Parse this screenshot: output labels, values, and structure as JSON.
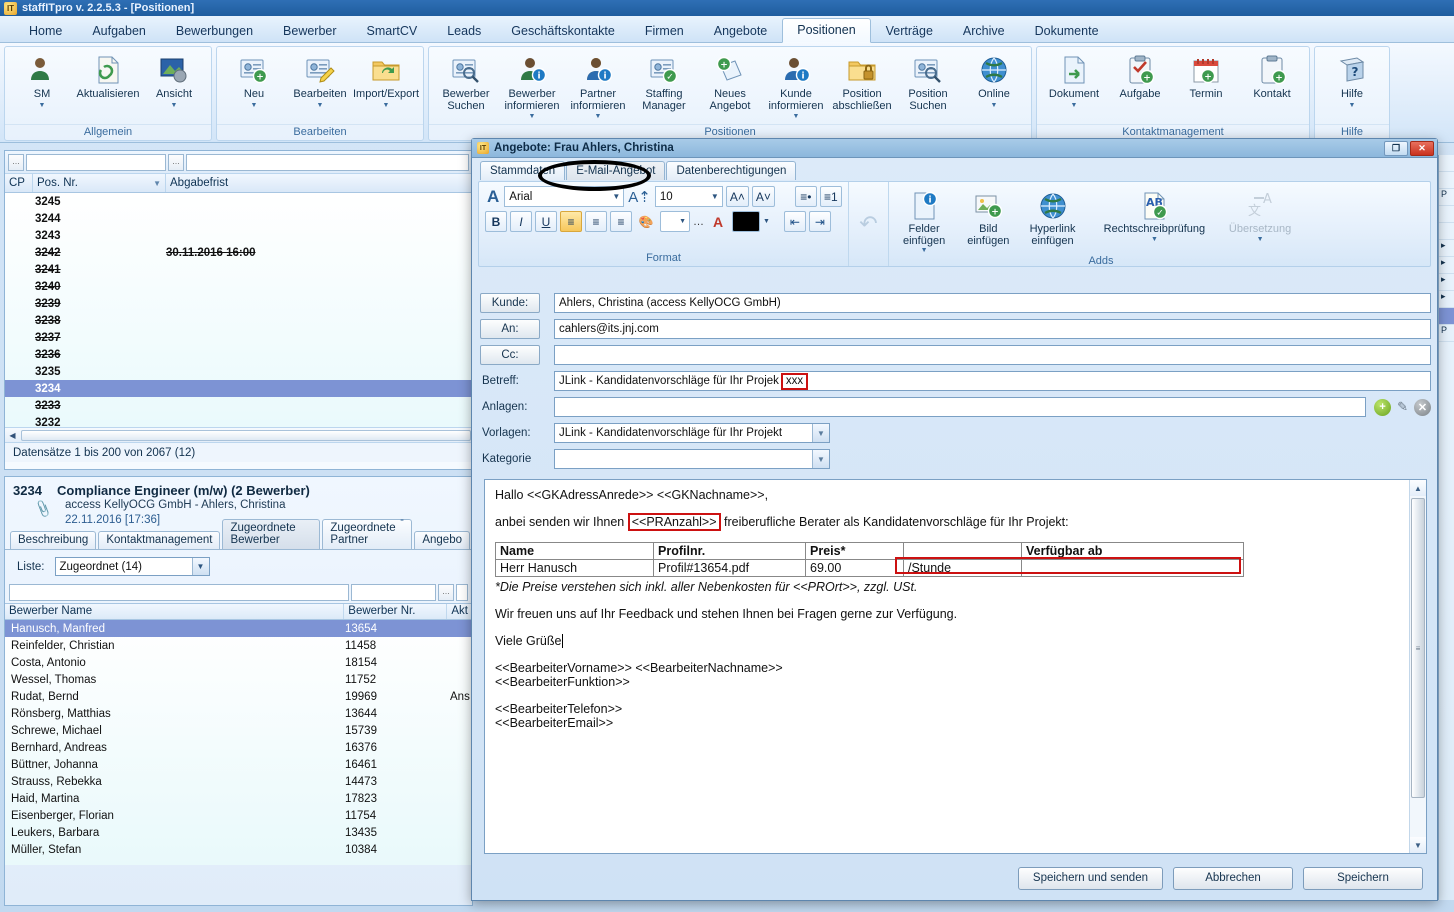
{
  "app": {
    "title": "staffITpro v. 2.2.5.3 - [Positionen]",
    "logo": "IT"
  },
  "ribbon": {
    "tabs": [
      {
        "label": "Home",
        "active": false
      },
      {
        "label": "Aufgaben",
        "active": false
      },
      {
        "label": "Bewerbungen",
        "active": false
      },
      {
        "label": "Bewerber",
        "active": false
      },
      {
        "label": "SmartCV",
        "active": false
      },
      {
        "label": "Leads",
        "active": false
      },
      {
        "label": "Geschäftskontakte",
        "active": false
      },
      {
        "label": "Firmen",
        "active": false
      },
      {
        "label": "Angebote",
        "active": false
      },
      {
        "label": "Positionen",
        "active": true
      },
      {
        "label": "Verträge",
        "active": false
      },
      {
        "label": "Archive",
        "active": false
      },
      {
        "label": "Dokumente",
        "active": false
      }
    ],
    "groups": [
      {
        "label": "Allgemein",
        "buttons": [
          {
            "label": "SM",
            "icon": "person-icon",
            "caret": true
          },
          {
            "label": "Aktualisieren",
            "icon": "refresh-link-icon",
            "caret": false
          },
          {
            "label": "Ansicht",
            "icon": "view-settings-icon",
            "caret": true
          }
        ]
      },
      {
        "label": "Bearbeiten",
        "buttons": [
          {
            "label": "Neu",
            "icon": "new-record-icon",
            "caret": true
          },
          {
            "label": "Bearbeiten",
            "icon": "edit-record-icon",
            "caret": true
          },
          {
            "label": "Import/Export",
            "icon": "folder-sync-icon",
            "caret": true
          }
        ]
      },
      {
        "label": "Positionen",
        "buttons": [
          {
            "label": "Bewerber\nSuchen",
            "icon": "person-search-icon",
            "caret": false
          },
          {
            "label": "Bewerber\ninformieren",
            "icon": "person-info-icon",
            "caret": true
          },
          {
            "label": "Partner\ninformieren",
            "icon": "partner-info-icon",
            "caret": true
          },
          {
            "label": "Staffing\nManager",
            "icon": "person-check-icon",
            "caret": false
          },
          {
            "label": "Neues\nAngebot",
            "icon": "new-offer-icon",
            "caret": false
          },
          {
            "label": "Kunde\ninformieren",
            "icon": "customer-info-icon",
            "caret": true
          },
          {
            "label": "Position\nabschließen",
            "icon": "folder-lock-icon",
            "caret": false
          },
          {
            "label": "Position\nSuchen",
            "icon": "position-search-icon",
            "caret": false
          },
          {
            "label": "Online",
            "icon": "globe-icon",
            "caret": true
          }
        ]
      },
      {
        "label": "Kontaktmanagement",
        "buttons": [
          {
            "label": "Dokument",
            "icon": "document-icon",
            "caret": true
          },
          {
            "label": "Aufgabe",
            "icon": "task-add-icon",
            "caret": false
          },
          {
            "label": "Termin",
            "icon": "calendar-add-icon",
            "caret": false
          },
          {
            "label": "Kontakt",
            "icon": "contact-add-icon",
            "caret": false
          }
        ]
      },
      {
        "label": "Hilfe",
        "buttons": [
          {
            "label": "Hilfe",
            "icon": "help-book-icon",
            "caret": true
          }
        ]
      }
    ]
  },
  "positions_grid": {
    "columns": [
      "CP",
      "Pos. Nr.",
      "Abgabefrist"
    ],
    "sorted_column": "Pos. Nr.",
    "rows": [
      {
        "nr": "3245",
        "frist": "",
        "strike": false,
        "selected": false
      },
      {
        "nr": "3244",
        "frist": "",
        "strike": false,
        "selected": false
      },
      {
        "nr": "3243",
        "frist": "",
        "strike": false,
        "selected": false
      },
      {
        "nr": "3242",
        "frist": "30.11.2016 16:00",
        "strike": true,
        "selected": false
      },
      {
        "nr": "3241",
        "frist": "",
        "strike": true,
        "selected": false
      },
      {
        "nr": "3240",
        "frist": "",
        "strike": true,
        "selected": false
      },
      {
        "nr": "3239",
        "frist": "",
        "strike": true,
        "selected": false
      },
      {
        "nr": "3238",
        "frist": "",
        "strike": true,
        "selected": false
      },
      {
        "nr": "3237",
        "frist": "",
        "strike": true,
        "selected": false
      },
      {
        "nr": "3236",
        "frist": "",
        "strike": true,
        "selected": false
      },
      {
        "nr": "3235",
        "frist": "",
        "strike": false,
        "selected": false
      },
      {
        "nr": "3234",
        "frist": "",
        "strike": false,
        "selected": true
      },
      {
        "nr": "3233",
        "frist": "",
        "strike": true,
        "selected": false
      },
      {
        "nr": "3232",
        "frist": "",
        "strike": false,
        "selected": false
      }
    ],
    "status": "Datensätze 1 bis 200 von 2067 (12)"
  },
  "detail": {
    "number": "3234",
    "title": "Compliance Engineer (m/w) (2 Bewerber)",
    "subtitle": "access KellyOCG GmbH - Ahlers, Christina",
    "date": "22.11.2016 [17:36]",
    "date_right": "-",
    "tabs": [
      {
        "label": "Beschreibung",
        "active": false
      },
      {
        "label": "Kontaktmanagement",
        "active": false
      },
      {
        "label": "Zugeordnete Bewerber",
        "active": true
      },
      {
        "label": "Zugeordnete Partner",
        "active": false
      },
      {
        "label": "Angebo",
        "active": false
      }
    ],
    "liste_label": "Liste:",
    "liste_value": "Zugeordnet (14)",
    "columns": [
      "Bewerber Name",
      "Bewerber Nr.",
      "Akt"
    ],
    "rows": [
      {
        "name": "Hanusch, Manfred",
        "nr": "13654",
        "akt": "",
        "selected": true
      },
      {
        "name": "Reinfelder, Christian",
        "nr": "11458",
        "akt": "",
        "selected": false
      },
      {
        "name": "Costa, Antonio",
        "nr": "18154",
        "akt": "",
        "selected": false
      },
      {
        "name": "Wessel, Thomas",
        "nr": "11752",
        "akt": "",
        "selected": false
      },
      {
        "name": "Rudat, Bernd",
        "nr": "19969",
        "akt": "Ans",
        "selected": false
      },
      {
        "name": "Rönsberg, Matthias",
        "nr": "13644",
        "akt": "",
        "selected": false
      },
      {
        "name": "Schrewe, Michael",
        "nr": "15739",
        "akt": "",
        "selected": false
      },
      {
        "name": "Bernhard, Andreas",
        "nr": "16376",
        "akt": "",
        "selected": false
      },
      {
        "name": "Büttner, Johanna",
        "nr": "16461",
        "akt": "",
        "selected": false
      },
      {
        "name": "Strauss, Rebekka",
        "nr": "14473",
        "akt": "",
        "selected": false
      },
      {
        "name": "Haid, Martina",
        "nr": "17823",
        "akt": "",
        "selected": false
      },
      {
        "name": "Eisenberger, Florian",
        "nr": "11754",
        "akt": "",
        "selected": false
      },
      {
        "name": "Leukers, Barbara",
        "nr": "13435",
        "akt": "",
        "selected": false
      },
      {
        "name": "Müller, Stefan",
        "nr": "10384",
        "akt": "",
        "selected": false
      }
    ]
  },
  "dialog": {
    "title": "Angebote: Frau Ahlers, Christina",
    "logo": "IT",
    "restore_label": "❐",
    "close_label": "✕",
    "tabs": [
      {
        "label": "Stammdaten",
        "active": false
      },
      {
        "label": "E-Mail-Angebot",
        "active": true
      },
      {
        "label": "Datenberechtigungen",
        "active": false
      }
    ],
    "format": {
      "group_label": "Format",
      "font_icon": "font-color-A-icon",
      "font_name": "Arial",
      "size_icon": "font-size-icon",
      "font_size": "10",
      "grow_font": "A˄",
      "shrink_font": "A˅",
      "bold": "B",
      "italic": "I",
      "underline": "U",
      "align_left": "≡",
      "align_center": "≡",
      "align_right": "≡",
      "highlight_icon": "highlight-fill-icon",
      "fill_more": "…",
      "font_color_icon": "font-color-icon",
      "bullets": "bullet-list-icon",
      "numbering": "numbered-list-icon",
      "outdent": "decrease-indent-icon",
      "indent": "increase-indent-icon",
      "undo": "undo-icon"
    },
    "adds": {
      "group_label": "Adds",
      "buttons": [
        {
          "label": "Felder\neinfügen",
          "icon": "insert-field-icon",
          "caret": true,
          "disabled": false
        },
        {
          "label": "Bild\neinfügen",
          "icon": "insert-image-icon",
          "caret": false,
          "disabled": false
        },
        {
          "label": "Hyperlink\neinfügen",
          "icon": "insert-hyperlink-icon",
          "caret": false,
          "disabled": false
        },
        {
          "label": "Rechtschreibprüfung",
          "icon": "spellcheck-icon",
          "caret": true,
          "disabled": false
        },
        {
          "label": "Übersetzung",
          "icon": "translate-icon",
          "caret": true,
          "disabled": true
        }
      ]
    },
    "fields": {
      "kunde_label": "Kunde:",
      "kunde_value": "Ahlers, Christina (access KellyOCG GmbH)",
      "an_label": "An:",
      "an_value": "cahlers@its.jnj.com",
      "cc_label": "Cc:",
      "cc_value": "",
      "betreff_label": "Betreff:",
      "betreff_value": "JLink - Kandidatenvorschläge für Ihr Projek",
      "betreff_highlight": "xxx",
      "anlagen_label": "Anlagen:",
      "anlagen_value": "",
      "vorlagen_label": "Vorlagen:",
      "vorlagen_value": "JLink - Kandidatenvorschläge für Ihr Projekt",
      "kategorie_label": "Kategorie",
      "kategorie_value": "",
      "attach_add_icon": "add-attachment-icon",
      "attach_edit_icon": "edit-attachment-icon",
      "attach_delete_icon": "delete-attachment-icon"
    },
    "body": {
      "greeting": "Hallo <<GKAdressAnrede>> <<GKNachname>>,",
      "intro_before": "anbei senden wir Ihnen ",
      "intro_field": "<<PRAnzahl>>",
      "intro_after": " freiberufliche Berater als Kandidatenvorschläge für Ihr Projekt:",
      "table": {
        "headers": [
          "Name",
          "Profilnr.",
          "Preis*",
          "",
          "Verfügbar ab"
        ],
        "rows": [
          [
            "Herr Hanusch",
            "Profil#13654.pdf",
            "69.00",
            "/Stunde",
            ""
          ]
        ]
      },
      "footnote": "*Die Preise verstehen sich inkl. aller Nebenkosten für <<PROrt>>, zzgl. USt.",
      "feedback": "Wir freuen uns auf Ihr Feedback und stehen Ihnen bei Fragen gerne zur Verfügung.",
      "regards": "Viele Grüße",
      "sig_name": "<<BearbeiterVorname>> <<BearbeiterNachname>>",
      "sig_role": "<<BearbeiterFunktion>>",
      "sig_phone": "<<BearbeiterTelefon>>",
      "sig_email": "<<BearbeiterEmail>>"
    },
    "footer": {
      "save_send": "Speichern und senden",
      "cancel": "Abbrechen",
      "save": "Speichern"
    }
  },
  "colors": {
    "annotation_red": "#cc1111",
    "annotation_black": "#000000",
    "selection_blue": "#7d93d4",
    "accent_blue": "#2f6fb5"
  }
}
